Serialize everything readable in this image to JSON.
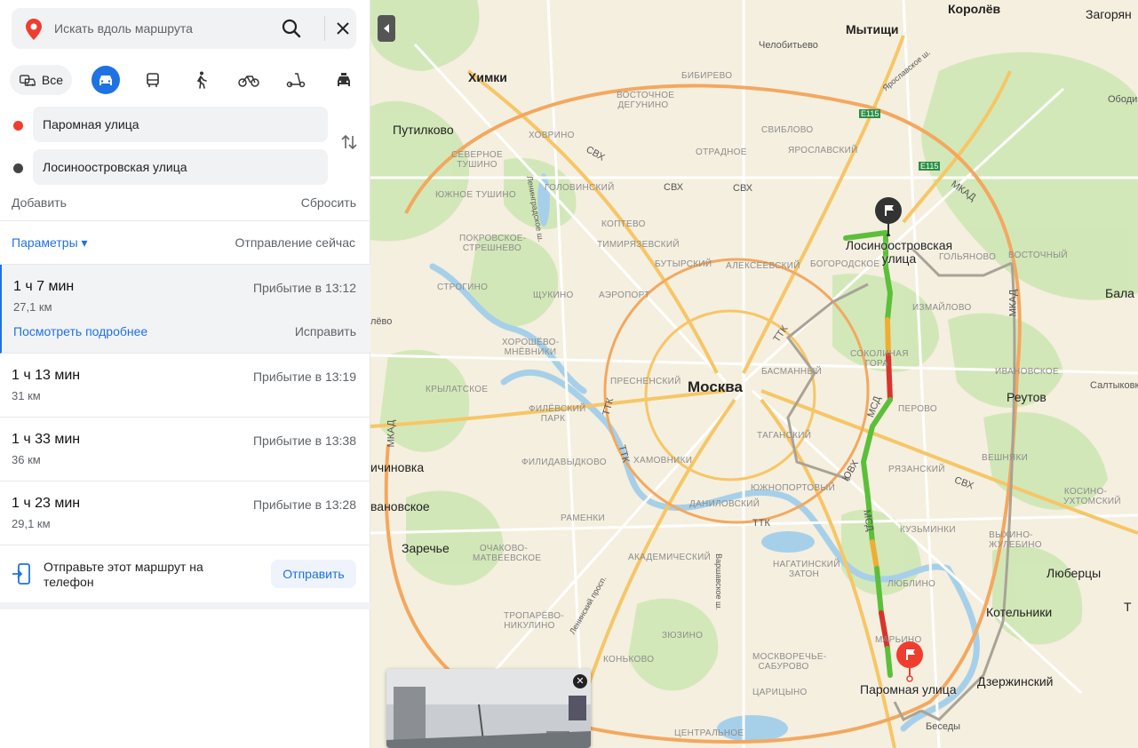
{
  "search": {
    "placeholder": "Искать вдоль маршрута"
  },
  "modes": {
    "all_label": "Все",
    "items": [
      "car-icon",
      "bus-icon",
      "walk-icon",
      "bike-icon",
      "scooter-icon",
      "taxi-icon"
    ],
    "active": "car"
  },
  "route_points": {
    "from": "Паромная улица",
    "to": "Лосиноостровская улица"
  },
  "actions": {
    "add": "Добавить",
    "reset": "Сбросить"
  },
  "params": {
    "label": "Параметры ▾",
    "departure": "Отправление сейчас"
  },
  "routes": [
    {
      "time": "1 ч 7 мин",
      "distance": "27,1 км",
      "arrival": "Прибытие в 13:12",
      "details": "Посмотреть подробнее",
      "fix": "Исправить"
    },
    {
      "time": "1 ч 13 мин",
      "distance": "31 км",
      "arrival": "Прибытие в 13:19"
    },
    {
      "time": "1 ч 33 мин",
      "distance": "36 км",
      "arrival": "Прибытие в 13:38"
    },
    {
      "time": "1 ч 23 мин",
      "distance": "29,1 км",
      "arrival": "Прибытие в 13:28"
    }
  ],
  "send": {
    "text": "Отправьте этот маршрут на телефон",
    "button": "Отправить"
  },
  "map": {
    "cities": [
      "Королёв",
      "Загорян",
      "Мытищи",
      "Химки",
      "Путилково",
      "Москва",
      "Реутов",
      "Бала",
      "Люберцы",
      "Котельники",
      "Дзержинский",
      "Заречье",
      "ичиновка",
      "вановское",
      "лёво",
      "Т"
    ],
    "districts": [
      "Челобитьево",
      "Бибирево",
      "Восточное Дегунино",
      "Ховрино",
      "Северное Тушино",
      "Отрадное",
      "Свиблово",
      "Ярославский",
      "Головинский",
      "Южное Тушино",
      "Коптево",
      "Тимирязевский",
      "Покровское-Стрешнево",
      "Бутырский",
      "Алексеевский",
      "Богородское",
      "Гольяново",
      "Восточный",
      "Строгино",
      "Щукино",
      "Аэропорт",
      "Измайлово",
      "Хорошёво-Мнёвники",
      "Басманный",
      "Соколиная гора",
      "Ивановское",
      "Пресненский",
      "Крылатское",
      "Филёвский парк",
      "Перово",
      "Таганский",
      "Хамовники",
      "Филидавыдково",
      "Рязанский",
      "Вешняки",
      "Южнопортовый",
      "Косино-Ухтомский",
      "Даниловский",
      "Раменки",
      "Кузьминки",
      "Выхино-Жулебино",
      "Очаково-Матвеевское",
      "Академический",
      "Нагатинский затон",
      "Люблино",
      "Тропарёво-Никулино",
      "Зюзино",
      "Марьино",
      "Москворечье-Сабурово",
      "Царицыно",
      "Коньково",
      "Центральное",
      "Салтыковк",
      "Ободи"
    ],
    "roads": [
      "СВХ",
      "МКАД",
      "ТТК",
      "МСД",
      "ЮВХ",
      "E115",
      "Ленинградское ш.",
      "Ярославское ш.",
      "Варшавское ш.",
      "Ленинский просп."
    ],
    "end_label": "Лосиноостровская улица",
    "start_label": "Паромная улица",
    "village": "Беседы"
  }
}
